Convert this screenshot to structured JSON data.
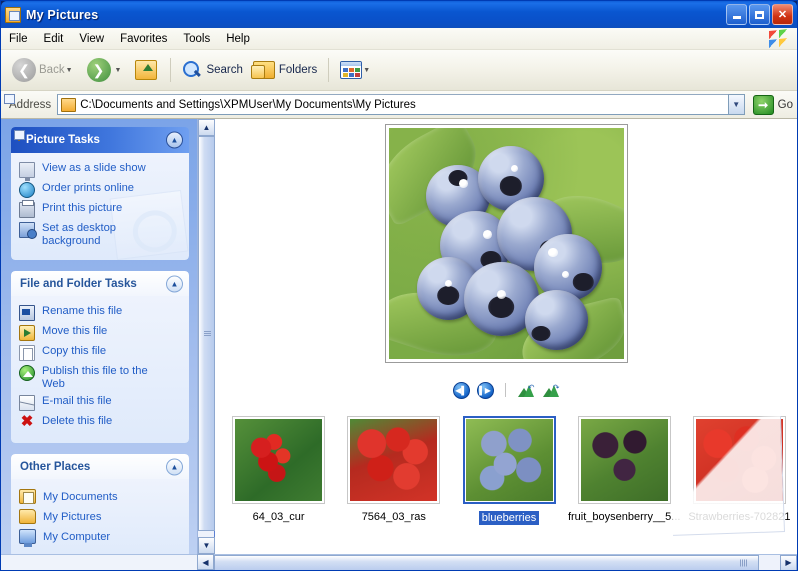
{
  "window": {
    "title": "My Pictures",
    "icon": "folder-picture-icon",
    "minimize": "_",
    "maximize": "□",
    "close": "✕"
  },
  "menu": {
    "items": [
      {
        "label": "File"
      },
      {
        "label": "Edit"
      },
      {
        "label": "View"
      },
      {
        "label": "Favorites"
      },
      {
        "label": "Tools"
      },
      {
        "label": "Help"
      }
    ]
  },
  "toolbar": {
    "back": "Back",
    "forward": "",
    "up": "",
    "search": "Search",
    "folders": "Folders",
    "views": ""
  },
  "address": {
    "label": "Address",
    "path": "C:\\Documents and Settings\\XPMUser\\My Documents\\My Pictures",
    "go": "Go"
  },
  "sidebar": {
    "picture_tasks": {
      "title": "Picture Tasks",
      "items": [
        {
          "label": "View as a slide show",
          "icon": "slideshow-icon"
        },
        {
          "label": "Order prints online",
          "icon": "globe-icon"
        },
        {
          "label": "Print this picture",
          "icon": "printer-icon"
        },
        {
          "label": "Set as desktop background",
          "icon": "desktop-icon"
        }
      ]
    },
    "file_folder_tasks": {
      "title": "File and Folder Tasks",
      "items": [
        {
          "label": "Rename this file",
          "icon": "rename-icon"
        },
        {
          "label": "Move this file",
          "icon": "move-icon"
        },
        {
          "label": "Copy this file",
          "icon": "copy-icon"
        },
        {
          "label": "Publish this file to the Web",
          "icon": "publish-icon"
        },
        {
          "label": "E-mail this file",
          "icon": "email-icon"
        },
        {
          "label": "Delete this file",
          "icon": "delete-icon"
        }
      ]
    },
    "other_places": {
      "title": "Other Places",
      "items": [
        {
          "label": "My Documents",
          "icon": "my-documents-icon"
        },
        {
          "label": "My Pictures",
          "icon": "my-pictures-icon"
        },
        {
          "label": "My Computer",
          "icon": "my-computer-icon"
        }
      ]
    }
  },
  "preview": {
    "image_alt": "blueberries",
    "controls": {
      "previous": "previous-image",
      "next": "next-image",
      "rotate_ccw": "rotate-counterclockwise",
      "rotate_cw": "rotate-clockwise"
    }
  },
  "filmstrip": {
    "items": [
      {
        "label": "64_03_cur",
        "selected": false,
        "art": "t-currant"
      },
      {
        "label": "7564_03_ras",
        "selected": false,
        "art": "t-rasp"
      },
      {
        "label": "blueberries",
        "selected": true,
        "art": "t-blue"
      },
      {
        "label": "fruit_boysenberry__5...",
        "selected": false,
        "art": "t-boysen"
      },
      {
        "label": "Strawberries-702821",
        "selected": false,
        "art": "t-straw"
      }
    ]
  },
  "colors": {
    "titlebar_blue": "#0a56d0",
    "selection_blue": "#2b5fc4",
    "task_link": "#215dc6",
    "panel_header_text": "#26559b"
  }
}
